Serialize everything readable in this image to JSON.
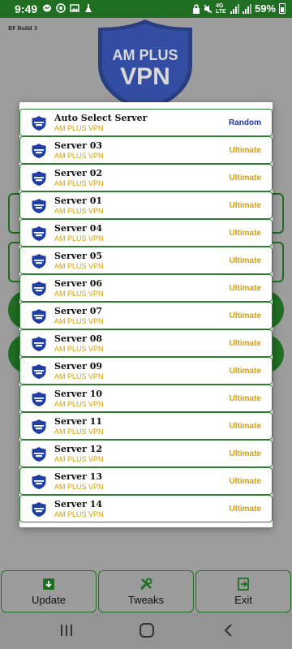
{
  "status_bar": {
    "time": "9:49",
    "network": "4G LTE",
    "battery": "59%",
    "left_icons": [
      "messenger-icon",
      "whatsapp-icon",
      "gallery-icon",
      "cleaner-icon"
    ],
    "right_icons": [
      "vpn-key-icon",
      "mute-icon",
      "signal-icon",
      "signal-icon"
    ]
  },
  "app": {
    "build_label": "BF Build 3",
    "logo_line1": "AM PLUS",
    "logo_line2": "VPN",
    "brand_color": "#1f6e22"
  },
  "dialog": {
    "servers": [
      {
        "name": "Auto Select Server",
        "provider": "AM PLUS VPN",
        "tag": "Random"
      },
      {
        "name": "Server 03",
        "provider": "AM PLUS VPN",
        "tag": "Ultimate"
      },
      {
        "name": "Server 02",
        "provider": "AM PLUS VPN",
        "tag": "Ultimate"
      },
      {
        "name": "Server 01",
        "provider": "AM PLUS VPN",
        "tag": "Ultimate"
      },
      {
        "name": "Server 04",
        "provider": "AM PLUS VPN",
        "tag": "Ultimate"
      },
      {
        "name": "Server 05",
        "provider": "AM PLUS VPN",
        "tag": "Ultimate"
      },
      {
        "name": "Server 06",
        "provider": "AM PLUS VPN",
        "tag": "Ultimate"
      },
      {
        "name": "Server 07",
        "provider": "AM PLUS VPN",
        "tag": "Ultimate"
      },
      {
        "name": "Server 08",
        "provider": "AM PLUS VPN",
        "tag": "Ultimate"
      },
      {
        "name": "Server 09",
        "provider": "AM PLUS VPN",
        "tag": "Ultimate"
      },
      {
        "name": "Server 10",
        "provider": "AM PLUS VPN",
        "tag": "Ultimate"
      },
      {
        "name": "Server 11",
        "provider": "AM PLUS VPN",
        "tag": "Ultimate"
      },
      {
        "name": "Server 12",
        "provider": "AM PLUS VPN",
        "tag": "Ultimate"
      },
      {
        "name": "Server 13",
        "provider": "AM PLUS VPN",
        "tag": "Ultimate"
      },
      {
        "name": "Server 14",
        "provider": "AM PLUS VPN",
        "tag": "Ultimate"
      }
    ]
  },
  "bottom_nav": {
    "update_label": "Update",
    "tweaks_label": "Tweaks",
    "exit_label": "Exit"
  },
  "system_nav": {
    "recents": "recents-icon",
    "home": "home-icon",
    "back": "back-icon"
  }
}
